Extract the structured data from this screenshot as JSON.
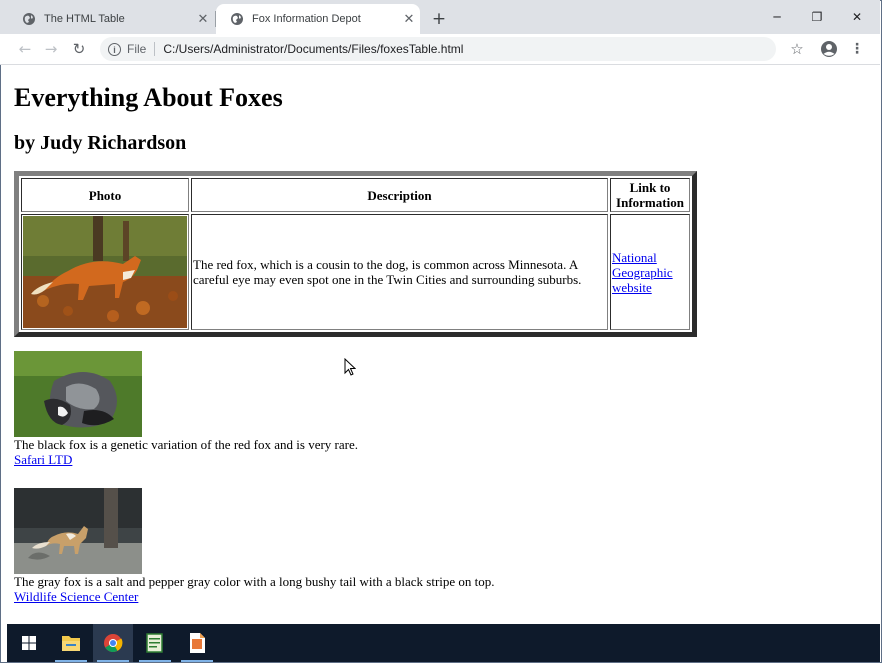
{
  "browser": {
    "tabs": [
      {
        "title": "The HTML Table",
        "active": false
      },
      {
        "title": "Fox Information Depot",
        "active": true
      }
    ],
    "address": {
      "scheme_label": "File",
      "url": "C:/Users/Administrator/Documents/Files/foxesTable.html"
    },
    "window_controls": {
      "minimize": "─",
      "restore": "❐",
      "close": "✕"
    },
    "new_tab": "+"
  },
  "page": {
    "heading": "Everything About Foxes",
    "byline": "by Judy Richardson",
    "table": {
      "headers": [
        "Photo",
        "Description",
        "Link to Information"
      ],
      "row": {
        "description": "The red fox, which is a cousin to the dog, is common across Minnesota. A careful eye may even spot one in the Twin Cities and surrounding suburbs.",
        "link_text": "National Geographic website"
      }
    },
    "foxes": [
      {
        "text": "The black fox is a genetic variation of the red fox and is very rare.",
        "link_text": "Safari LTD"
      },
      {
        "text": "The gray fox is a salt and pepper gray color with a long bushy tail with a black stripe on top.",
        "link_text": "Wildlife Science Center"
      }
    ]
  },
  "taskbar": {
    "items": [
      "windows-start-icon",
      "file-explorer-icon",
      "chrome-icon",
      "notepad-icon",
      "document-icon"
    ]
  },
  "colors": {
    "link": "#0000ee",
    "tabstrip": "#dee1e6",
    "taskbar": "#0e1a2b"
  }
}
